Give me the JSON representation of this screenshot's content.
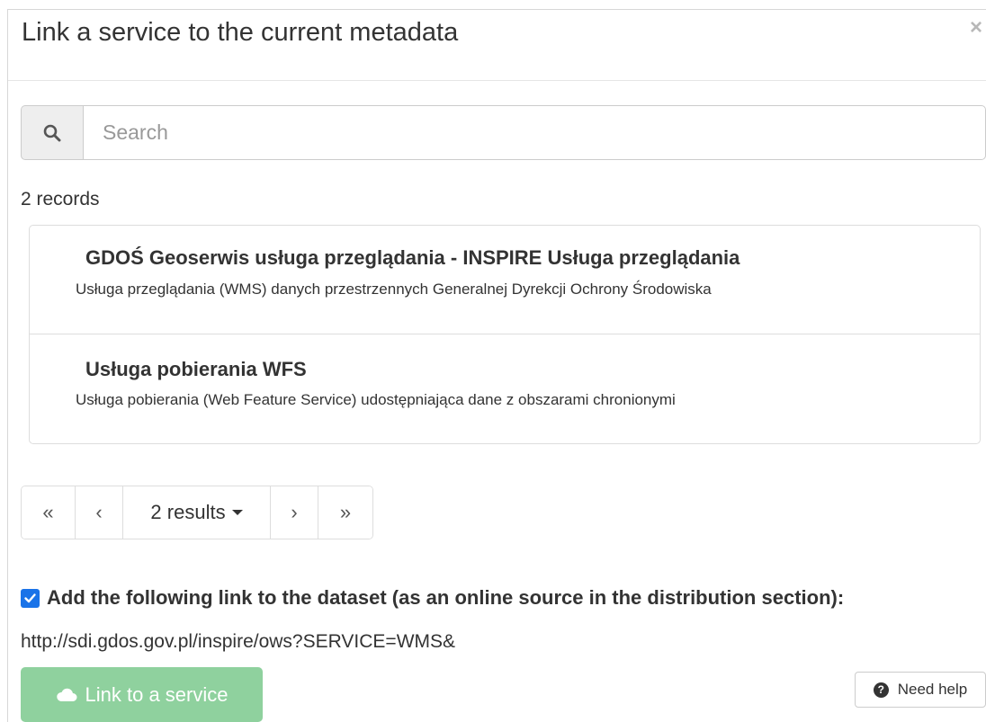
{
  "dialog": {
    "title": "Link a service to the current metadata",
    "close_symbol": "×"
  },
  "search": {
    "placeholder": "Search",
    "icon": "search-icon"
  },
  "results": {
    "count_text": "2 records",
    "items": [
      {
        "title": "GDOŚ Geoserwis usługa przeglądania - INSPIRE Usługa przeglądania",
        "description": "Usługa przeglądania (WMS) danych przestrzennych Generalnej Dyrekcji Ochrony Środowiska"
      },
      {
        "title": "Usługa pobierania WFS",
        "description": "Usługa pobierania (Web Feature Service) udostępniająca dane z obszarami chronionymi"
      }
    ]
  },
  "pagination": {
    "first": "«",
    "prev": "‹",
    "results_label": "2 results",
    "next": "›",
    "last": "»"
  },
  "link_option": {
    "checked": true,
    "label": "Add the following link to the dataset (as an online source in the distribution section):",
    "url": "http://sdi.gdos.gov.pl/inspire/ows?SERVICE=WMS&"
  },
  "actions": {
    "link_button": "Link to a service",
    "help_button": "Need help",
    "help_symbol": "?"
  },
  "colors": {
    "primary_checkbox": "#1a73e8",
    "success_disabled": "#8fd19e"
  }
}
